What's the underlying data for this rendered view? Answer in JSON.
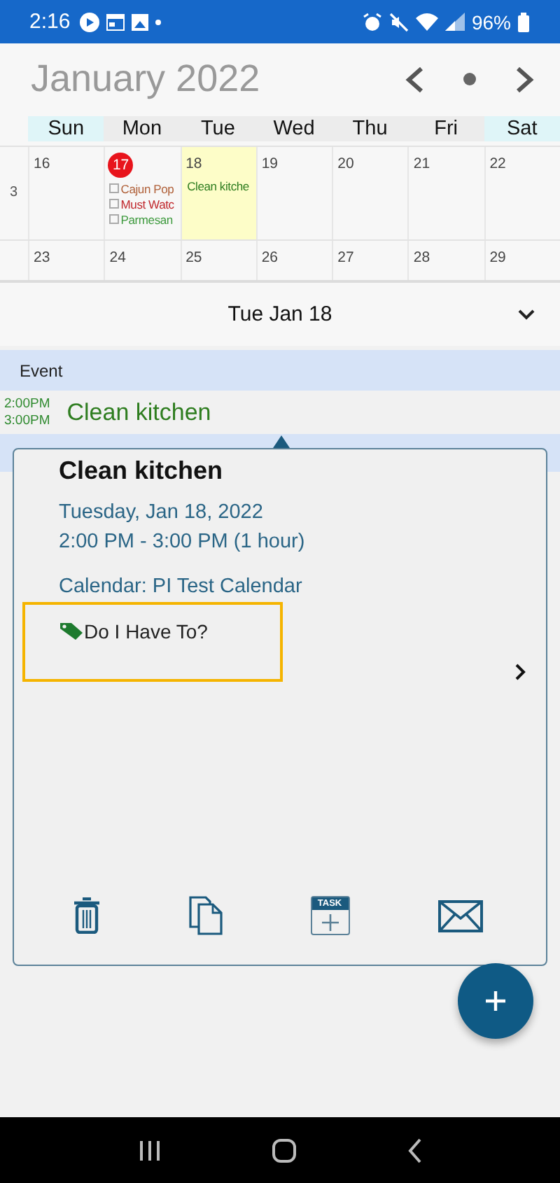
{
  "status_bar": {
    "time": "2:16",
    "battery": "96%"
  },
  "header": {
    "month_title": "January 2022"
  },
  "weekdays": [
    {
      "label": "Sun",
      "weekend": true
    },
    {
      "label": "Mon",
      "weekend": false
    },
    {
      "label": "Tue",
      "weekend": false
    },
    {
      "label": "Wed",
      "weekend": false
    },
    {
      "label": "Thu",
      "weekend": false
    },
    {
      "label": "Fri",
      "weekend": false
    },
    {
      "label": "Sat",
      "weekend": true
    }
  ],
  "weeks": [
    {
      "number": "3",
      "days": [
        {
          "date": "16",
          "today": false,
          "selected": false
        },
        {
          "date": "17",
          "today": true,
          "selected": false,
          "events": [
            {
              "kind": "task",
              "title": "Cajun Pop",
              "color": "#b0613a"
            },
            {
              "kind": "task",
              "title": "Must Watc",
              "color": "#c0282d"
            },
            {
              "kind": "task",
              "title": "Parmesan",
              "color": "#3f9a3f"
            }
          ]
        },
        {
          "date": "18",
          "today": false,
          "selected": true,
          "events": [
            {
              "kind": "event",
              "title": "Clean kitche",
              "color": "#2e7d1f"
            }
          ]
        },
        {
          "date": "19",
          "today": false,
          "selected": false
        },
        {
          "date": "20",
          "today": false,
          "selected": false
        },
        {
          "date": "21",
          "today": false,
          "selected": false
        },
        {
          "date": "22",
          "today": false,
          "selected": false
        }
      ]
    },
    {
      "days": [
        {
          "date": "23",
          "today": false,
          "selected": false
        },
        {
          "date": "24",
          "today": false,
          "selected": false
        },
        {
          "date": "25",
          "today": false,
          "selected": false
        },
        {
          "date": "26",
          "today": false,
          "selected": false
        },
        {
          "date": "27",
          "today": false,
          "selected": false
        },
        {
          "date": "28",
          "today": false,
          "selected": false
        },
        {
          "date": "29",
          "today": false,
          "selected": false
        }
      ]
    }
  ],
  "day_header": {
    "title": "Tue Jan 18"
  },
  "agenda": [
    {
      "label": "Event",
      "items": [
        {
          "start": "2:00PM",
          "end": "3:00PM",
          "title": "Clean kitchen"
        }
      ]
    }
  ],
  "popup": {
    "title": "Clean kitchen",
    "date": "Tuesday, Jan 18, 2022",
    "time": "2:00 PM - 3:00 PM (1 hour)",
    "calendar": "Calendar: PI Test Calendar",
    "tag": "Do I Have To?",
    "actions": [
      {
        "kind": "delete"
      },
      {
        "kind": "copy"
      },
      {
        "kind": "task",
        "label": "TASK"
      },
      {
        "kind": "email"
      }
    ]
  }
}
